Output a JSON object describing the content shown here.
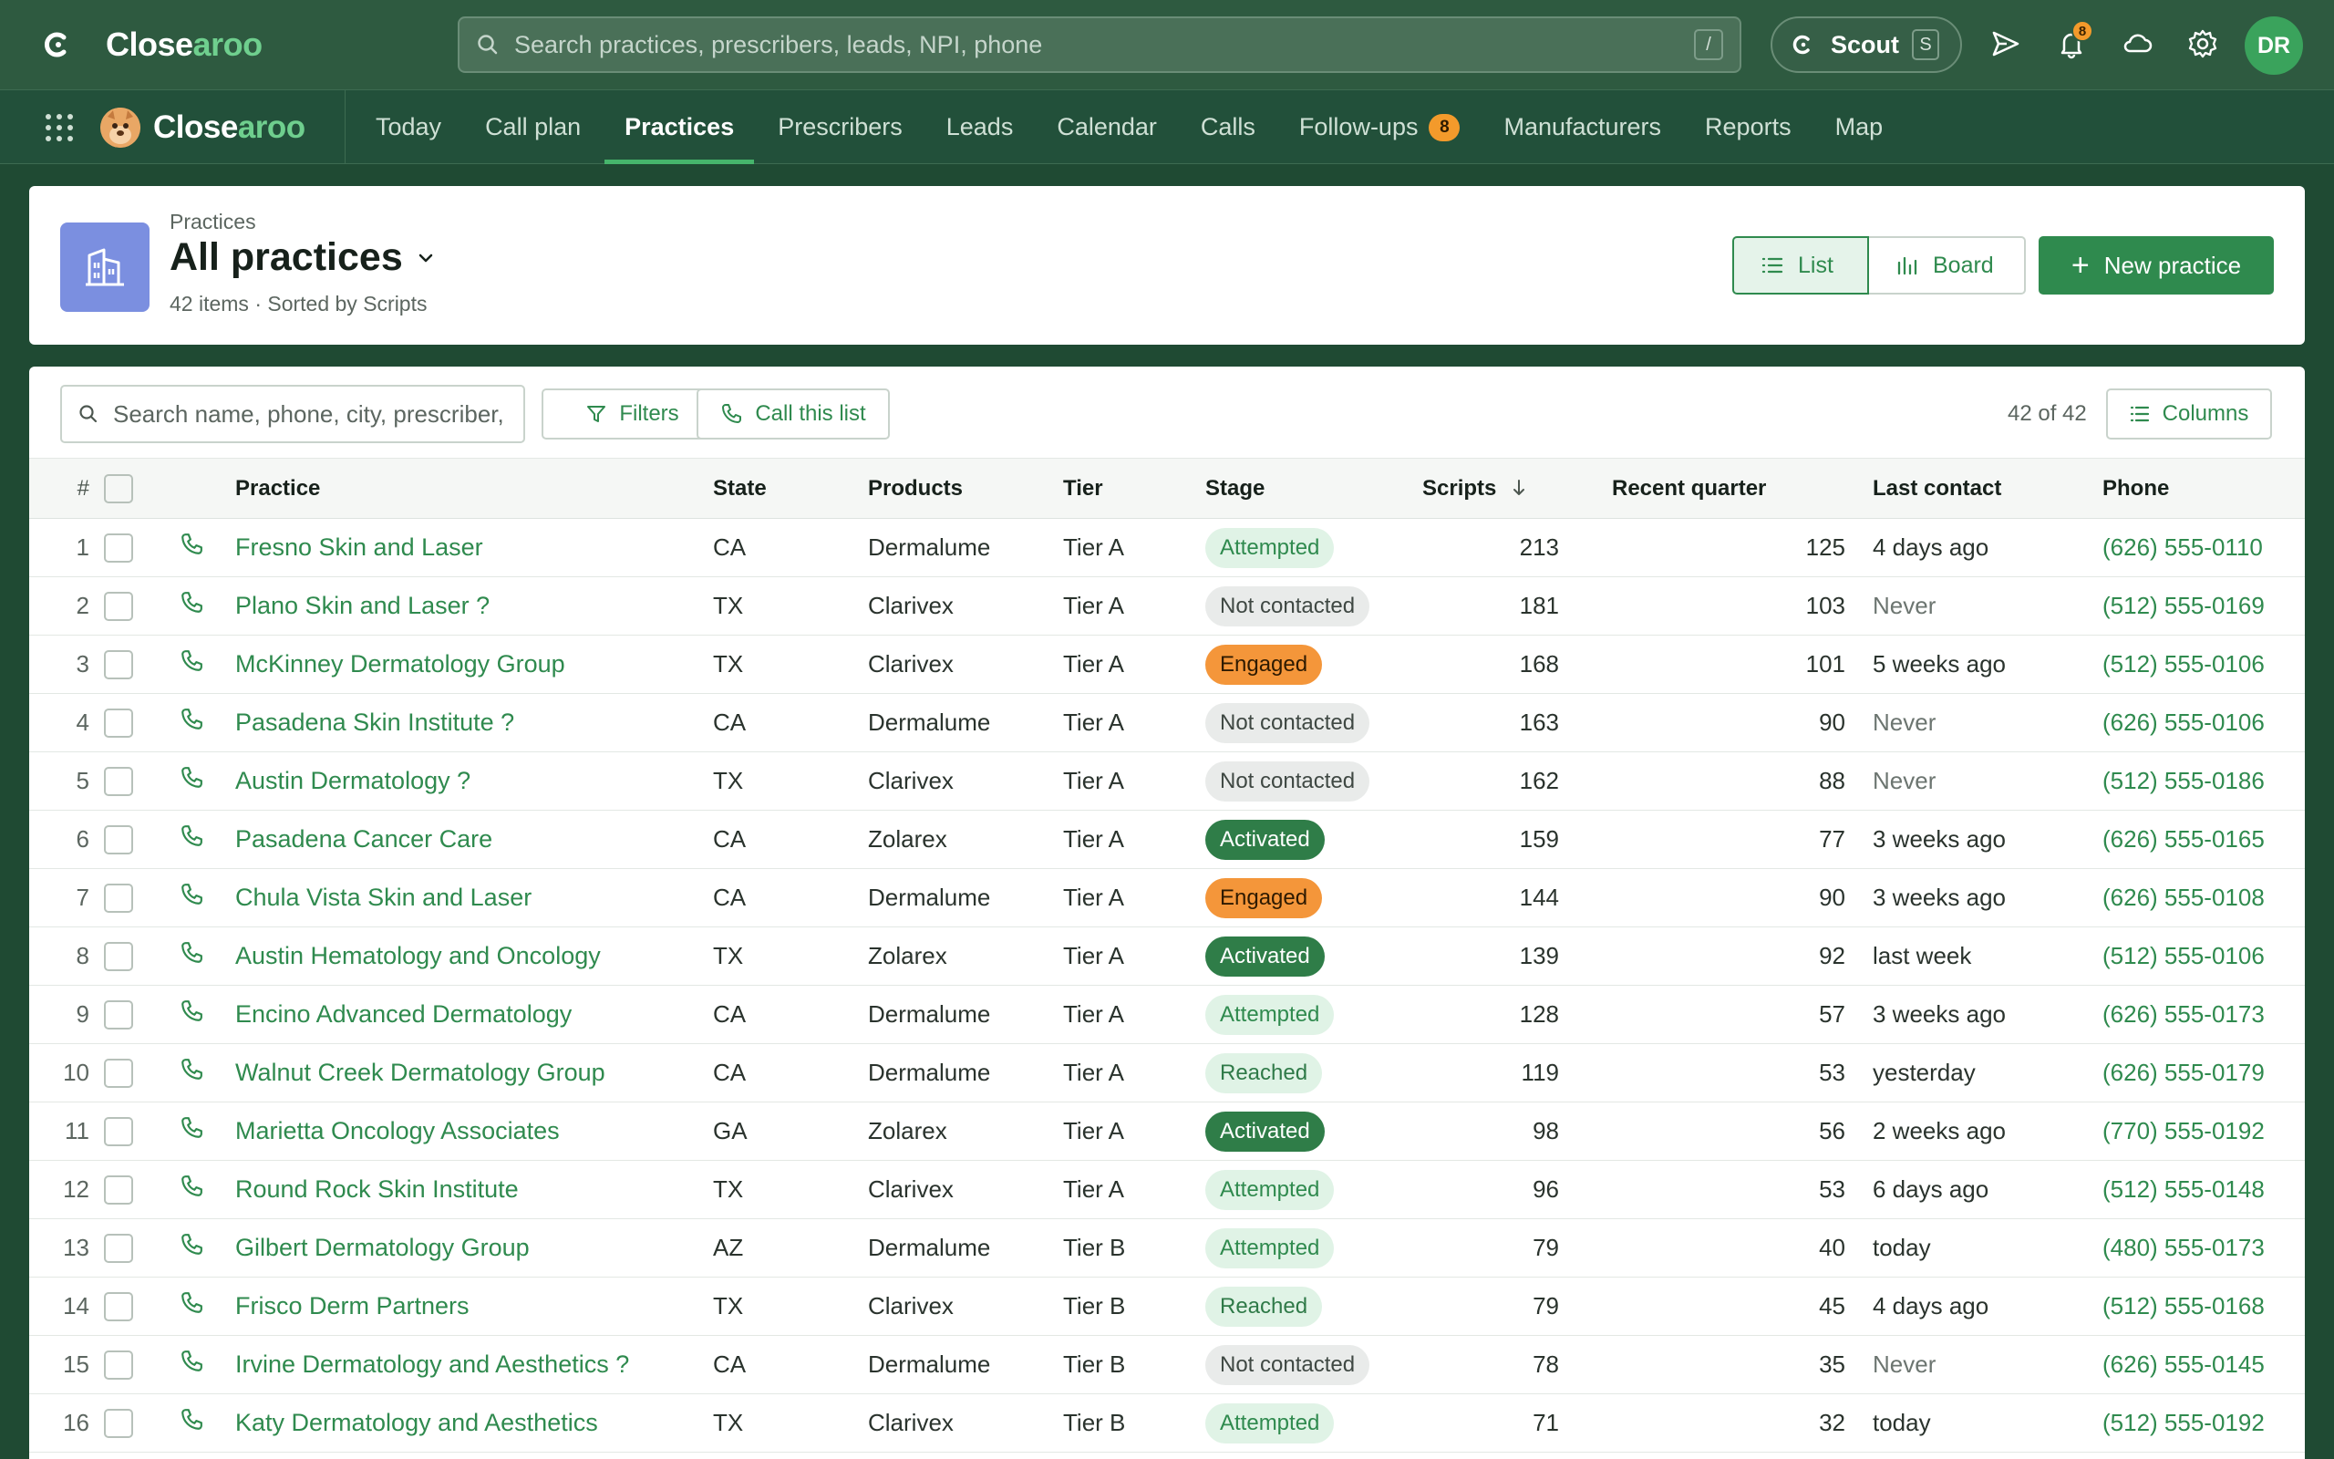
{
  "topbar": {
    "brand_main": "Close",
    "brand_accent": "aroo",
    "search_placeholder": "Search practices, prescribers, leads, NPI, phone",
    "search_shortcut": "/",
    "scout_label": "Scout",
    "scout_shortcut": "S",
    "notification_count": "8",
    "avatar_initials": "DR"
  },
  "nav": {
    "brand_main": "Close",
    "brand_accent": "aroo",
    "items": [
      {
        "label": "Today"
      },
      {
        "label": "Call plan"
      },
      {
        "label": "Practices"
      },
      {
        "label": "Prescribers"
      },
      {
        "label": "Leads"
      },
      {
        "label": "Calendar"
      },
      {
        "label": "Calls"
      },
      {
        "label": "Follow-ups",
        "count": "8"
      },
      {
        "label": "Manufacturers"
      },
      {
        "label": "Reports"
      },
      {
        "label": "Map"
      }
    ],
    "active": "Practices"
  },
  "header": {
    "breadcrumb": "Practices",
    "title": "All practices",
    "subtitle": "42 items · Sorted by Scripts",
    "view_list": "List",
    "view_board": "Board",
    "new_button": "New practice"
  },
  "toolbar": {
    "search_placeholder": "Search name, phone, city, prescriber,",
    "filters_label": "Filters",
    "call_list_label": "Call this list",
    "count": "42 of 42",
    "columns_label": "Columns"
  },
  "table": {
    "headers": {
      "num": "#",
      "practice": "Practice",
      "state": "State",
      "products": "Products",
      "tier": "Tier",
      "stage": "Stage",
      "scripts": "Scripts",
      "recent": "Recent quarter",
      "last_contact": "Last contact",
      "phone": "Phone"
    },
    "rows": [
      {
        "n": "1",
        "practice": "Fresno Skin and Laser",
        "state": "CA",
        "product": "Dermalume",
        "tier": "Tier A",
        "stage": "Attempted",
        "scripts": "213",
        "recent": "125",
        "last": "4 days ago",
        "phone": "(626) 555-0110"
      },
      {
        "n": "2",
        "practice": "Plano Skin and Laser ?",
        "state": "TX",
        "product": "Clarivex",
        "tier": "Tier A",
        "stage": "Not contacted",
        "scripts": "181",
        "recent": "103",
        "last": "Never",
        "phone": "(512) 555-0169"
      },
      {
        "n": "3",
        "practice": "McKinney Dermatology Group",
        "state": "TX",
        "product": "Clarivex",
        "tier": "Tier A",
        "stage": "Engaged",
        "scripts": "168",
        "recent": "101",
        "last": "5 weeks ago",
        "phone": "(512) 555-0106"
      },
      {
        "n": "4",
        "practice": "Pasadena Skin Institute ?",
        "state": "CA",
        "product": "Dermalume",
        "tier": "Tier A",
        "stage": "Not contacted",
        "scripts": "163",
        "recent": "90",
        "last": "Never",
        "phone": "(626) 555-0106"
      },
      {
        "n": "5",
        "practice": "Austin Dermatology ?",
        "state": "TX",
        "product": "Clarivex",
        "tier": "Tier A",
        "stage": "Not contacted",
        "scripts": "162",
        "recent": "88",
        "last": "Never",
        "phone": "(512) 555-0186"
      },
      {
        "n": "6",
        "practice": "Pasadena Cancer Care",
        "state": "CA",
        "product": "Zolarex",
        "tier": "Tier A",
        "stage": "Activated",
        "scripts": "159",
        "recent": "77",
        "last": "3 weeks ago",
        "phone": "(626) 555-0165"
      },
      {
        "n": "7",
        "practice": "Chula Vista Skin and Laser",
        "state": "CA",
        "product": "Dermalume",
        "tier": "Tier A",
        "stage": "Engaged",
        "scripts": "144",
        "recent": "90",
        "last": "3 weeks ago",
        "phone": "(626) 555-0108"
      },
      {
        "n": "8",
        "practice": "Austin Hematology and Oncology",
        "state": "TX",
        "product": "Zolarex",
        "tier": "Tier A",
        "stage": "Activated",
        "scripts": "139",
        "recent": "92",
        "last": "last week",
        "phone": "(512) 555-0106"
      },
      {
        "n": "9",
        "practice": "Encino Advanced Dermatology",
        "state": "CA",
        "product": "Dermalume",
        "tier": "Tier A",
        "stage": "Attempted",
        "scripts": "128",
        "recent": "57",
        "last": "3 weeks ago",
        "phone": "(626) 555-0173"
      },
      {
        "n": "10",
        "practice": "Walnut Creek Dermatology Group",
        "state": "CA",
        "product": "Dermalume",
        "tier": "Tier A",
        "stage": "Reached",
        "scripts": "119",
        "recent": "53",
        "last": "yesterday",
        "phone": "(626) 555-0179"
      },
      {
        "n": "11",
        "practice": "Marietta Oncology Associates",
        "state": "GA",
        "product": "Zolarex",
        "tier": "Tier A",
        "stage": "Activated",
        "scripts": "98",
        "recent": "56",
        "last": "2 weeks ago",
        "phone": "(770) 555-0192"
      },
      {
        "n": "12",
        "practice": "Round Rock Skin Institute",
        "state": "TX",
        "product": "Clarivex",
        "tier": "Tier A",
        "stage": "Attempted",
        "scripts": "96",
        "recent": "53",
        "last": "6 days ago",
        "phone": "(512) 555-0148"
      },
      {
        "n": "13",
        "practice": "Gilbert Dermatology Group",
        "state": "AZ",
        "product": "Dermalume",
        "tier": "Tier B",
        "stage": "Attempted",
        "scripts": "79",
        "recent": "40",
        "last": "today",
        "phone": "(480) 555-0173"
      },
      {
        "n": "14",
        "practice": "Frisco Derm Partners",
        "state": "TX",
        "product": "Clarivex",
        "tier": "Tier B",
        "stage": "Reached",
        "scripts": "79",
        "recent": "45",
        "last": "4 days ago",
        "phone": "(512) 555-0168"
      },
      {
        "n": "15",
        "practice": "Irvine Dermatology and Aesthetics ?",
        "state": "CA",
        "product": "Dermalume",
        "tier": "Tier B",
        "stage": "Not contacted",
        "scripts": "78",
        "recent": "35",
        "last": "Never",
        "phone": "(626) 555-0145"
      },
      {
        "n": "16",
        "practice": "Katy Dermatology and Aesthetics",
        "state": "TX",
        "product": "Clarivex",
        "tier": "Tier B",
        "stage": "Attempted",
        "scripts": "71",
        "recent": "32",
        "last": "today",
        "phone": "(512) 555-0192"
      }
    ]
  },
  "colors": {
    "brand_green": "#2f8a4e",
    "topbar_bg": "#2e5a40",
    "nav_bg": "#22503a",
    "engaged_orange": "#f4963a",
    "activated_green": "#2f7d48",
    "page_icon_blue": "#7b8fe0"
  }
}
